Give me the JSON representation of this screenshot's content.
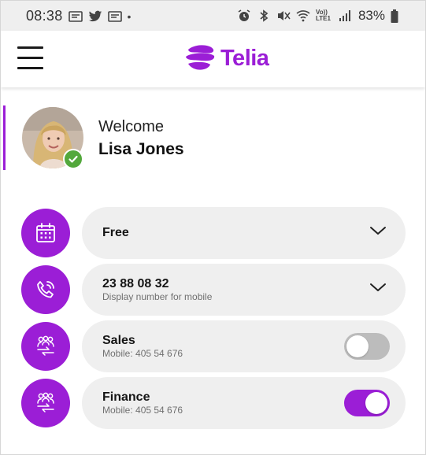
{
  "status_bar": {
    "time": "08:38",
    "dot": "•",
    "battery_percent": "83%",
    "volte_label": "Vo)) LTE1",
    "left_icons": [
      "notification-icon",
      "twitter-icon",
      "notification-icon"
    ],
    "right_icons": [
      "alarm-icon",
      "bluetooth-icon",
      "mute-icon",
      "wifi-icon",
      "volte-icon",
      "signal-icon",
      "battery-icon"
    ]
  },
  "header": {
    "menu_icon": "hamburger-menu-icon",
    "logo_text": "Telia",
    "brand_color": "#9b1ed6"
  },
  "welcome": {
    "label": "Welcome",
    "name": "Lisa Jones",
    "status_badge": "check-icon",
    "status_color": "#53a83c"
  },
  "rows": [
    {
      "icon": "calendar-icon",
      "title": "Free",
      "subtitle": "",
      "control": "dropdown"
    },
    {
      "icon": "phone-icon",
      "title": "23 88 08 32",
      "subtitle": "Display number for mobile",
      "control": "dropdown"
    },
    {
      "icon": "group-icon",
      "title": "Sales",
      "subtitle": "Mobile: 405 54 676",
      "control": "toggle",
      "toggle_on": false
    },
    {
      "icon": "group-icon",
      "title": "Finance",
      "subtitle": "Mobile: 405 54 676",
      "control": "toggle",
      "toggle_on": true
    }
  ]
}
